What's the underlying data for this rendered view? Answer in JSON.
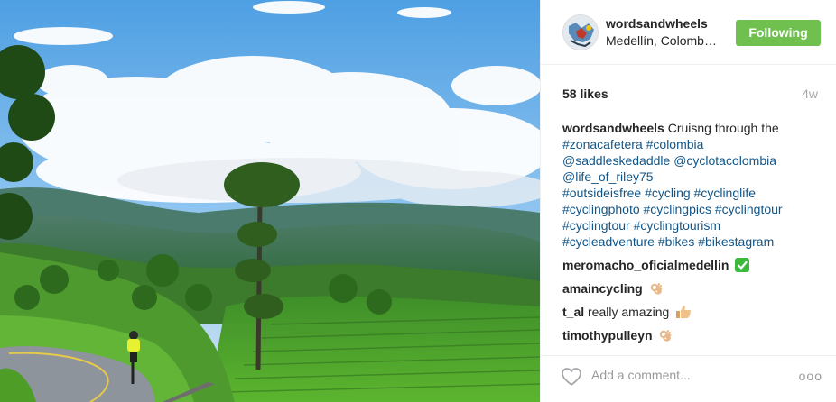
{
  "post": {
    "username": "wordsandwheels",
    "location": "Medellín, Colomb…",
    "follow_label": "Following",
    "follow_color": "#70c050",
    "likes": "58 likes",
    "age": "4w",
    "caption": {
      "user": "wordsandwheels",
      "text": " Cruisng through the",
      "tags": [
        "#zonacafetera",
        "#colombia",
        "@saddleskedaddle",
        "@cyclotacolombia",
        "@life_of_riley75",
        "#outsideisfree",
        "#cycling",
        "#cyclinglife",
        "#cyclingphoto",
        "#cyclingpics",
        "#cyclingtour",
        "#cyclingtour",
        "#cyclingtourism",
        "#cycleadventure",
        "#bikes",
        "#bikestagram"
      ]
    },
    "comments": [
      {
        "user": "meromacho_oficialmedellin",
        "text": "",
        "emoji": "check-mark-icon"
      },
      {
        "user": "amaincycling",
        "text": "",
        "emoji": "ok-hand-icon"
      },
      {
        "user": "t_al",
        "text": " really amazing",
        "emoji": "thumbs-up-icon"
      },
      {
        "user": "timothypulleyn",
        "text": "",
        "emoji": "ok-hand-icon"
      }
    ],
    "add_comment_placeholder": "Add a comment...",
    "more_label": "ooo",
    "link_color": "#125688"
  }
}
